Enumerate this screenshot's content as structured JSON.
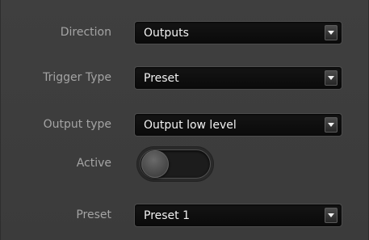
{
  "form": {
    "direction": {
      "label": "Direction",
      "value": "Outputs"
    },
    "trigger_type": {
      "label": "Trigger Type",
      "value": "Preset"
    },
    "output_type": {
      "label": "Output type",
      "value": "Output low level"
    },
    "active": {
      "label": "Active",
      "state": "off"
    },
    "preset": {
      "label": "Preset",
      "value": "Preset 1"
    }
  },
  "icons": {
    "dropdown": "chevron-down-icon"
  },
  "colors": {
    "background": "#3d3d3d",
    "label_text": "#a4a4a4",
    "field_background": "#111111",
    "field_text": "#f2f2f2"
  }
}
